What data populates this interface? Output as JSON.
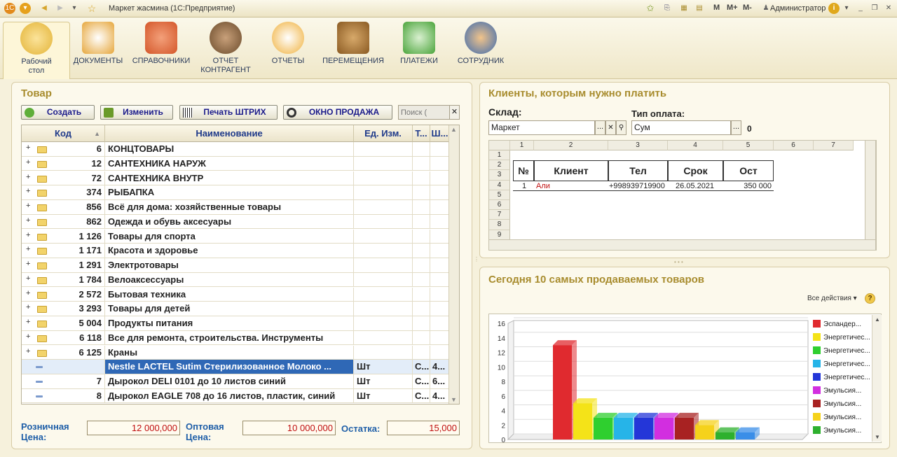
{
  "window": {
    "title": "Маркет жасмина  (1С:Предприятие)",
    "user": "Администратор",
    "mem": [
      "M",
      "M+",
      "M-"
    ]
  },
  "sections": [
    {
      "label": "Рабочий\nстол",
      "icon": "home-icon"
    },
    {
      "label": "ДОКУМЕНТЫ",
      "icon": "documents-icon"
    },
    {
      "label": "СПРАВОЧНИКИ",
      "icon": "contacts-icon"
    },
    {
      "label": "ОТЧЕТ\nКОНТРАГЕНТ",
      "icon": "agent-icon"
    },
    {
      "label": "ОТЧЕТЫ",
      "icon": "reports-icon"
    },
    {
      "label": "ПЕРЕМЕЩЕНИЯ",
      "icon": "box-icon"
    },
    {
      "label": "ПЛАТЕЖИ",
      "icon": "payments-icon"
    },
    {
      "label": "СОТРУДНИК",
      "icon": "staff-icon"
    }
  ],
  "goods": {
    "title": "Товар",
    "buttons": {
      "create": "Создать",
      "edit": "Изменить",
      "print": "Печать ШТРИХ",
      "sale": "ОКНО ПРОДАЖА",
      "search_placeholder": "Поиск ("
    },
    "columns": [
      "Код",
      "Наименование",
      "Ед. Изм.",
      "Т...",
      "Ш..."
    ],
    "rows": [
      {
        "code": "6",
        "name": "КОНЦТОВАРЫ",
        "unit": "",
        "c4": "",
        "c5": "",
        "folder": true
      },
      {
        "code": "12",
        "name": "САНТЕХНИКА НАРУЖ",
        "unit": "",
        "c4": "",
        "c5": "",
        "folder": true
      },
      {
        "code": "72",
        "name": "САНТЕХНИКА ВНУТР",
        "unit": "",
        "c4": "",
        "c5": "",
        "folder": true
      },
      {
        "code": "374",
        "name": "РЫБАПКА",
        "unit": "",
        "c4": "",
        "c5": "",
        "folder": true
      },
      {
        "code": "856",
        "name": "Всё для дома: хозяйственные товары",
        "unit": "",
        "c4": "",
        "c5": "",
        "folder": true
      },
      {
        "code": "862",
        "name": "Одежда и обувь аксесуары",
        "unit": "",
        "c4": "",
        "c5": "",
        "folder": true
      },
      {
        "code": "1 126",
        "name": "Товары для спорта",
        "unit": "",
        "c4": "",
        "c5": "",
        "folder": true
      },
      {
        "code": "1 171",
        "name": "Красота и здоровье",
        "unit": "",
        "c4": "",
        "c5": "",
        "folder": true
      },
      {
        "code": "1 291",
        "name": "Электротовары",
        "unit": "",
        "c4": "",
        "c5": "",
        "folder": true
      },
      {
        "code": "1 784",
        "name": "Велоаксессуары",
        "unit": "",
        "c4": "",
        "c5": "",
        "folder": true
      },
      {
        "code": "2 572",
        "name": "Бытовая техника",
        "unit": "",
        "c4": "",
        "c5": "",
        "folder": true
      },
      {
        "code": "3 293",
        "name": "Товары для детей",
        "unit": "",
        "c4": "",
        "c5": "",
        "folder": true
      },
      {
        "code": "5 004",
        "name": "Продукты питания",
        "unit": "",
        "c4": "",
        "c5": "",
        "folder": true
      },
      {
        "code": "6 118",
        "name": "Все для ремонта, строительства. Инструменты",
        "unit": "",
        "c4": "",
        "c5": "",
        "folder": true
      },
      {
        "code": "6 125",
        "name": "Краны",
        "unit": "",
        "c4": "",
        "c5": "",
        "folder": true
      },
      {
        "code": "",
        "name": "Nestle LACTEL Sutim Стерилизованное Молоко ...",
        "unit": "Шт",
        "c4": "С...",
        "c5": "4...",
        "folder": false,
        "selected": true
      },
      {
        "code": "7",
        "name": "Дырокол DELI 0101 до 10 листов синий",
        "unit": "Шт",
        "c4": "С...",
        "c5": "6...",
        "folder": false
      },
      {
        "code": "8",
        "name": "Дырокол EAGLE 708 до 16 листов, пластик, синий",
        "unit": "Шт",
        "c4": "С...",
        "c5": "4...",
        "folder": false
      }
    ],
    "retail_label": "Розничная\nЦена:",
    "retail_value": "12 000,000",
    "wholesale_label": "Оптовая\nЦена:",
    "wholesale_value": "10 000,000",
    "stock_label": "Остатка:",
    "stock_value": "15,000"
  },
  "clients": {
    "title": "Клиенты, которым нужно платить",
    "warehouse_label": "Склад:",
    "warehouse_value": "Маркет",
    "paytype_label": "Тип оплата:",
    "paytype_value": "Сум",
    "count": "0",
    "col_numbers": [
      "1",
      "2",
      "3",
      "4",
      "5",
      "6",
      "7"
    ],
    "row_numbers": [
      "1",
      "2",
      "3",
      "4",
      "5",
      "6",
      "7",
      "8",
      "9"
    ],
    "headers": [
      "№",
      "Клиент",
      "Тел",
      "Срок",
      "Ост"
    ],
    "rows": [
      {
        "n": "1",
        "client": "Али",
        "phone": "+998939719900",
        "date": "26.05.2021",
        "rest": "350 000"
      }
    ]
  },
  "top10": {
    "title": "Сегодня 10 самых продаваемых товаров",
    "all_actions": "Все действия",
    "help": "?"
  },
  "chart_data": {
    "type": "bar",
    "ylim": [
      0,
      16
    ],
    "yticks": [
      0,
      2,
      4,
      6,
      8,
      10,
      12,
      14,
      16
    ],
    "series": [
      {
        "name": "Эспандер...",
        "value": 13,
        "color": "#e02a2f"
      },
      {
        "name": "Энергетичес...",
        "value": 5,
        "color": "#f4e318"
      },
      {
        "name": "Энергетичес...",
        "value": 3,
        "color": "#2fcf2f"
      },
      {
        "name": "Энергетичес...",
        "value": 3,
        "color": "#26b4e8"
      },
      {
        "name": "Энергетичес...",
        "value": 3,
        "color": "#2436d8"
      },
      {
        "name": "Эмульсия...",
        "value": 3,
        "color": "#d22ee0"
      },
      {
        "name": "Эмульсия...",
        "value": 3,
        "color": "#a82222"
      },
      {
        "name": "Эмульсия...",
        "value": 2,
        "color": "#f5d21b"
      },
      {
        "name": "Эмульсия...",
        "value": 1,
        "color": "#2eb02e"
      },
      {
        "name": "",
        "value": 1,
        "color": "#3a8ee8"
      }
    ]
  }
}
